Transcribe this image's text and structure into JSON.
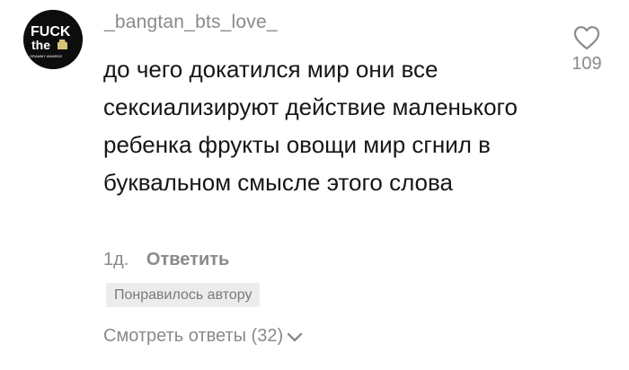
{
  "comment": {
    "avatar": {
      "line1": "FUCK",
      "line2": "the",
      "line3": "GRAMMY AWARDS"
    },
    "username": "_bangtan_bts_love_",
    "text": "до чего докатился мир они все сексиализируют действие маленького ребенка фрукты овощи мир сгнил в буквальном смысле этого слова",
    "like_count": "109",
    "time": "1д.",
    "reply_label": "Ответить",
    "liked_by_author_label": "Понравилось автору",
    "view_replies_label": "Смотреть ответы (32)"
  },
  "icons": {
    "like": "heart-icon",
    "expand": "chevron-down-icon"
  },
  "colors": {
    "text": "#161616",
    "secondary": "#8a8a8a",
    "badge_bg": "#ececec",
    "avatar_bg": "#0d0d0d"
  }
}
